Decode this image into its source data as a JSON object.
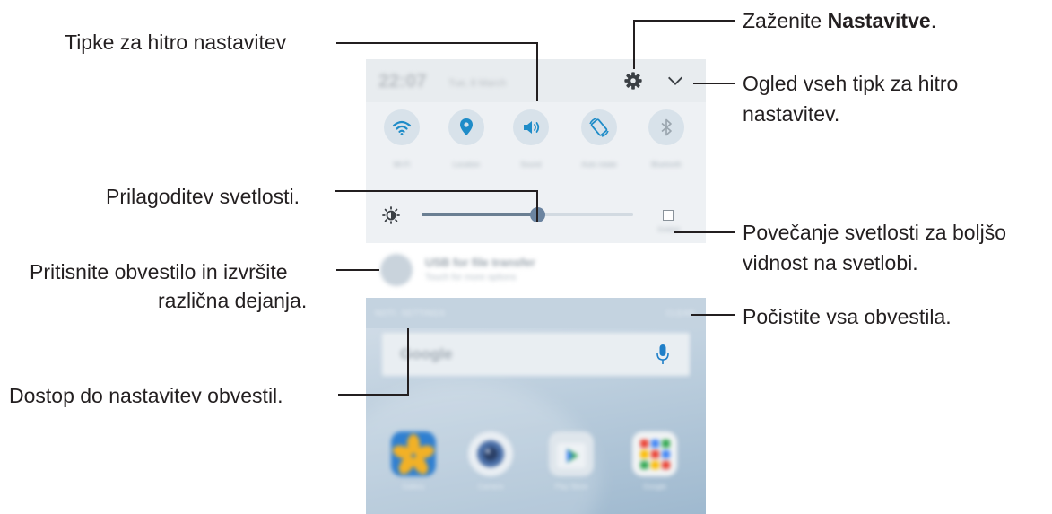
{
  "phone": {
    "status_bar": {
      "time": "22:07",
      "date": "Tue, 8 March"
    },
    "quick_settings": [
      {
        "icon": "wifi-icon",
        "label": "Wi-Fi"
      },
      {
        "icon": "location-icon",
        "label": "Location"
      },
      {
        "icon": "sound-icon",
        "label": "Sound"
      },
      {
        "icon": "auto-rotate-icon",
        "label": "Auto rotate"
      },
      {
        "icon": "bluetooth-icon",
        "label": "Bluetooth"
      }
    ],
    "brightness": {
      "level": 0.55,
      "outdoor_label": "Outdoor"
    },
    "notification": {
      "title": "USB for file transfer",
      "subtitle": "Touch for more options"
    },
    "notify_settings_label": "NOTI. SETTINGS",
    "clear_label": "CLEAR",
    "search": {
      "logo": "Google"
    },
    "apps": [
      {
        "name": "Gallery",
        "color": "#e8a020"
      },
      {
        "name": "Camera",
        "color": "#4a6fa8"
      },
      {
        "name": "Play Store",
        "color": "#dfe6ec"
      },
      {
        "name": "Google",
        "color": "#f1f3f4"
      }
    ],
    "colors": {
      "accent": "#1f8cc8",
      "icon_circle": "#d8e2ea"
    }
  },
  "callouts": {
    "quick_settings": "Tipke za hitro nastavitev",
    "settings_prefix": "Zaženite ",
    "settings_bold": "Nastavitve",
    "settings_suffix": ".",
    "view_all_1": "Ogled vseh tipk za hitro",
    "view_all_2": "nastavitev.",
    "brightness": "Prilagoditev svetlosti.",
    "outdoor_1": "Povečanje svetlosti za boljšo",
    "outdoor_2": "vidnost na svetlobi.",
    "notification_1": "Pritisnite obvestilo in izvršite",
    "notification_2": "različna dejanja.",
    "clear": "Počistite vsa obvestila.",
    "noti_settings": "Dostop do nastavitev obvestil."
  }
}
